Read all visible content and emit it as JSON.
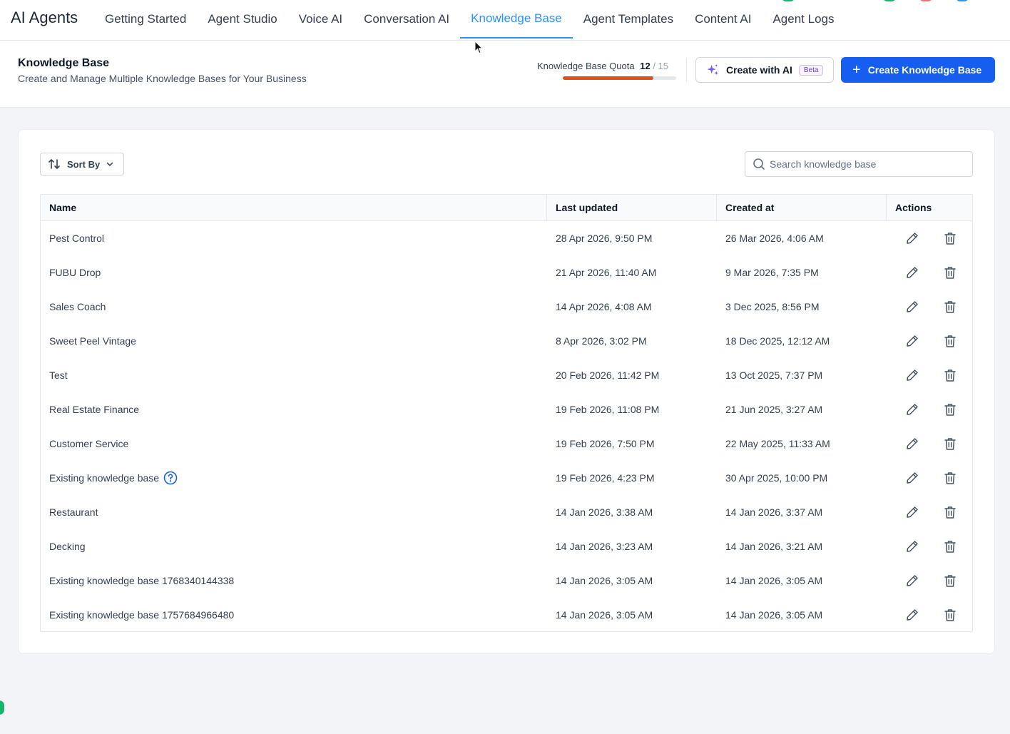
{
  "app_title": "AI Agents",
  "tabs": [
    {
      "label": "Getting Started"
    },
    {
      "label": "Agent Studio"
    },
    {
      "label": "Voice AI"
    },
    {
      "label": "Conversation AI"
    },
    {
      "label": "Knowledge Base"
    },
    {
      "label": "Agent Templates"
    },
    {
      "label": "Content AI"
    },
    {
      "label": "Agent Logs"
    }
  ],
  "active_tab": "Knowledge Base",
  "header": {
    "title": "Knowledge Base",
    "subtitle": "Create and Manage Multiple Knowledge Bases for Your Business",
    "quota_label": "Knowledge Base Quota",
    "quota_used": "12",
    "quota_total": "/ 15",
    "quota_fraction": 0.8,
    "create_ai_label": "Create with AI",
    "beta_label": "Beta",
    "create_kb_label": "Create Knowledge Base"
  },
  "toolbar": {
    "sort_label": "Sort By",
    "search_placeholder": "Search knowledge base"
  },
  "table": {
    "columns": [
      "Name",
      "Last updated",
      "Created at",
      "Actions"
    ],
    "rows": [
      {
        "name": "Pest Control",
        "updated": "28 Apr 2026, 9:50 PM",
        "created": "26 Mar 2026, 4:06 AM"
      },
      {
        "name": "FUBU Drop",
        "updated": "21 Apr 2026, 11:40 AM",
        "created": "9 Mar 2026, 7:35 PM"
      },
      {
        "name": "Sales Coach",
        "updated": "14 Apr 2026, 4:08 AM",
        "created": "3 Dec 2025, 8:56 PM"
      },
      {
        "name": "Sweet Peel Vintage",
        "updated": "8 Apr 2026, 3:02 PM",
        "created": "18 Dec 2025, 12:12 AM"
      },
      {
        "name": "Test",
        "updated": "20 Feb 2026, 11:42 PM",
        "created": "13 Oct 2025, 7:37 PM"
      },
      {
        "name": "Real Estate Finance",
        "updated": "19 Feb 2026, 11:08 PM",
        "created": "21 Jun 2025, 3:27 AM"
      },
      {
        "name": "Customer Service",
        "updated": "19 Feb 2026, 7:50 PM",
        "created": "22 May 2025, 11:33 AM"
      },
      {
        "name": "Existing knowledge base",
        "updated": "19 Feb 2026, 4:23 PM",
        "created": "30 Apr 2025, 10:00 PM",
        "help_icon": true
      },
      {
        "name": "Restaurant",
        "updated": "14 Jan 2026, 3:38 AM",
        "created": "14 Jan 2026, 3:37 AM"
      },
      {
        "name": "Decking",
        "updated": "14 Jan 2026, 3:23 AM",
        "created": "14 Jan 2026, 3:21 AM"
      },
      {
        "name": "Existing knowledge base 1768340144338",
        "updated": "14 Jan 2026, 3:05 AM",
        "created": "14 Jan 2026, 3:05 AM"
      },
      {
        "name": "Existing knowledge base 1757684966480",
        "updated": "14 Jan 2026, 3:05 AM",
        "created": "14 Jan 2026, 3:05 AM"
      }
    ]
  },
  "colors": {
    "accent": "#2e90fa",
    "primary_button": "#155eef",
    "quota_fill": "#e04f16",
    "beta": "#6941c6"
  },
  "icons": {
    "sort": "sort-arrows-icon",
    "dropdown": "chevron-down-icon",
    "search": "search-icon",
    "edit": "pencil-icon",
    "delete": "trash-icon",
    "help": "question-circle-icon",
    "ai": "sparkles-icon",
    "add": "plus-icon"
  }
}
